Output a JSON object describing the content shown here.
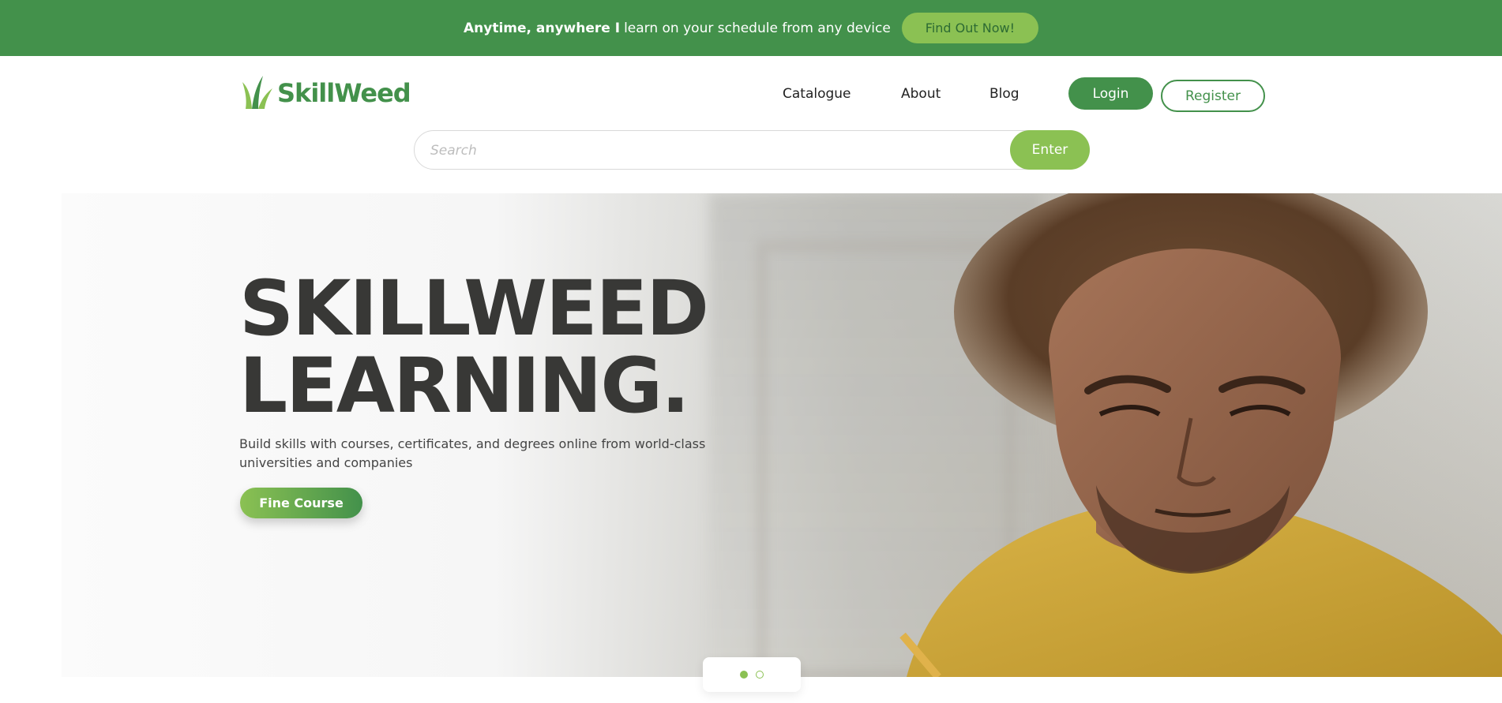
{
  "promo": {
    "bold_text": "Anytime, anywhere I",
    "text": "learn on your schedule from any device",
    "button_label": "Find Out Now!"
  },
  "header": {
    "logo_text": "SkillWeed",
    "nav": [
      "Catalogue",
      "About",
      "Blog"
    ],
    "login_label": "Login",
    "register_label": "Register"
  },
  "search": {
    "placeholder": "Search",
    "value": "",
    "button_label": "Enter"
  },
  "hero": {
    "title_line1": "SKILLWEED",
    "title_line2": "LEARNING.",
    "subtitle": "Build skills with courses, certificates, and degrees online from world-class universities and companies",
    "cta_label": "Fine Course"
  },
  "carousel": {
    "slides": 2,
    "active_slide": 1
  },
  "colors": {
    "brand_green": "#43914b",
    "light_green": "#8bc153",
    "title_dark": "#383836"
  }
}
